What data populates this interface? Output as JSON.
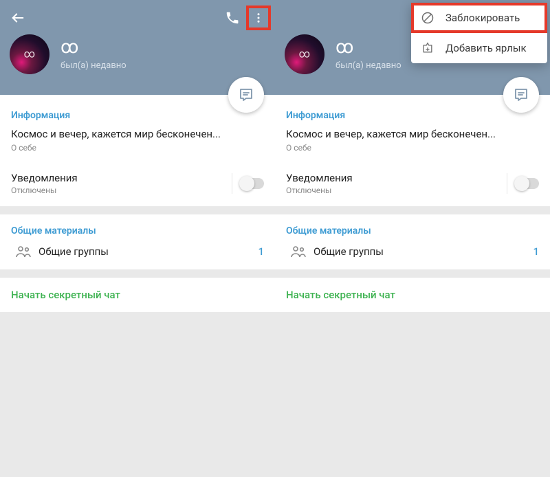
{
  "left": {
    "display_name": "ꝏ",
    "last_seen": "был(а) недавно",
    "info_section_label": "Информация",
    "bio_text": "Космос и вечер, кажется мир бесконечен...",
    "bio_sub": "О себе",
    "notifications_title": "Уведомления",
    "notifications_sub": "Отключены",
    "shared_section_label": "Общие материалы",
    "shared_groups_label": "Общие группы",
    "shared_groups_count": "1",
    "secret_chat_label": "Начать секретный чат"
  },
  "right": {
    "display_name": "ꝏ",
    "last_seen": "был(а) недавно",
    "info_section_label": "Информация",
    "bio_text": "Космос и вечер, кажется мир бесконечен...",
    "bio_sub": "О себе",
    "notifications_title": "Уведомления",
    "notifications_sub": "Отключены",
    "shared_section_label": "Общие материалы",
    "shared_groups_label": "Общие группы",
    "shared_groups_count": "1",
    "secret_chat_label": "Начать секретный чат",
    "menu": {
      "block": "Заблокировать",
      "add_shortcut": "Добавить ярлык"
    }
  }
}
